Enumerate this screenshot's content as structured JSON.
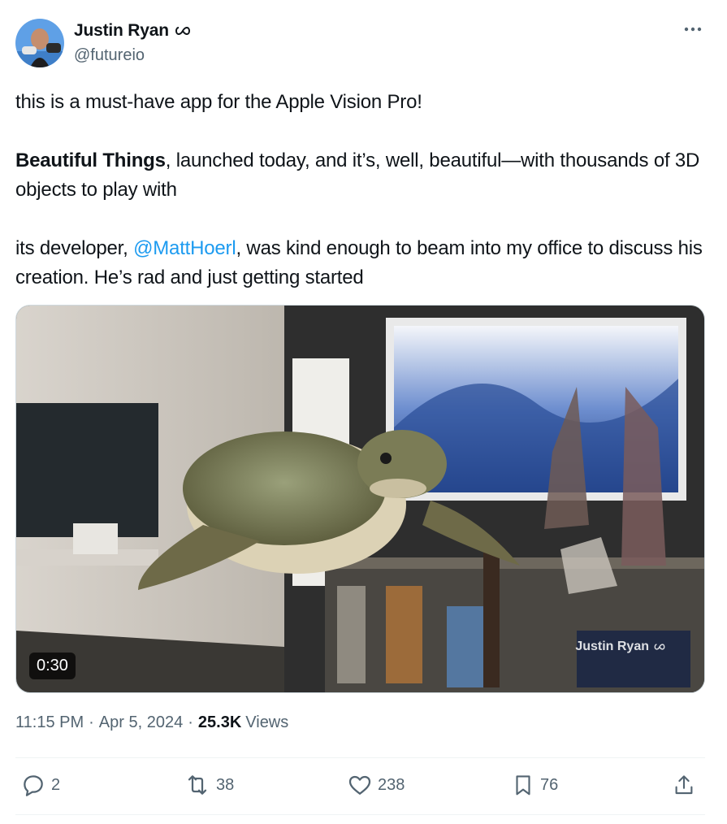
{
  "author": {
    "display_name": "Justin Ryan",
    "handle": "@futureio",
    "badge_icon": "infinity-icon"
  },
  "tweet": {
    "line1": "this is a must-have app for the Apple Vision Pro!",
    "bold_text": "Beautiful Things",
    "para2_rest": ", launched today, and it’s, well, beautiful—with thousands of 3D objects to play with",
    "para3_pre": "its developer, ",
    "mention": "@MattHoerl",
    "para3_post": ", was kind enough to beam into my office to discuss his creation. He’s rad and just getting started"
  },
  "media": {
    "duration": "0:30",
    "watermark": "Justin Ryan"
  },
  "meta": {
    "time": "11:15 PM",
    "separator": "·",
    "date": "Apr 5, 2024",
    "views_count": "25.3K",
    "views_label": "Views"
  },
  "actions": {
    "replies": "2",
    "reposts": "38",
    "likes": "238",
    "bookmarks": "76"
  },
  "colors": {
    "link": "#1d9bf0",
    "secondary_text": "#536471",
    "primary_text": "#0f1419"
  }
}
